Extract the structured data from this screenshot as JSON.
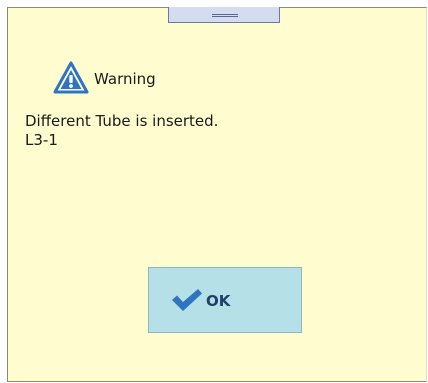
{
  "dialog": {
    "title": "Warning",
    "title_icon": "warning-triangle-icon",
    "message_lines": [
      "Different Tube is inserted.",
      "L3-1"
    ],
    "ok_label": "OK",
    "ok_icon": "checkmark-icon"
  },
  "colors": {
    "background": "#fffdd0",
    "button_background": "#b6e0e8",
    "accent_blue": "#2f74c0",
    "handle": "#d4dcf0"
  }
}
